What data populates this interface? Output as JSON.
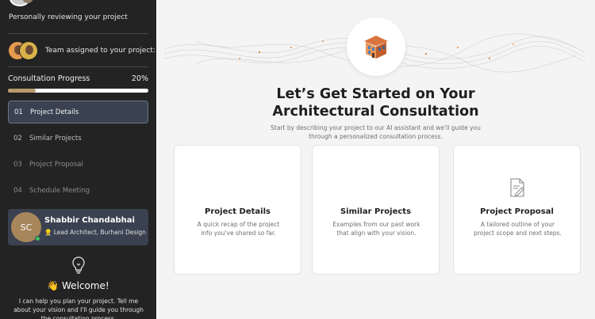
{
  "sidebar": {
    "review_text": "Personally reviewing your project",
    "team_text": "Team assigned to your project:",
    "progress": {
      "label": "Consultation Progress",
      "percent_text": "20%",
      "value": 0.2
    },
    "steps": [
      {
        "num": "01",
        "label": "Project Details"
      },
      {
        "num": "02",
        "label": "Similar Projects"
      },
      {
        "num": "03",
        "label": "Project Proposal"
      },
      {
        "num": "04",
        "label": "Schedule Meeting"
      }
    ],
    "architect": {
      "initials": "SC",
      "name": "Shabbir Chandabhai",
      "role": "👷 Lead Architect, Burhani Design"
    },
    "welcome_title": "👋 Welcome!",
    "welcome_body": "I can help you plan your project. Tell me about your vision and I'll guide you through the consultation process."
  },
  "main": {
    "headline_line1": "Let’s Get Started on Your",
    "headline_line2": "Architectural Consultation",
    "subtext": "Start by describing your project to our AI assistant and we'll guide you through a personalized consultation process.",
    "cards": [
      {
        "title": "Project Details",
        "desc": "A quick recap of the project info you've shared so far."
      },
      {
        "title": "Similar Projects",
        "desc": "Examples from our past work that align with your vision."
      },
      {
        "title": "Project Proposal",
        "desc": "A tailored outline of your project scope and next steps.",
        "icon": "document-edit-icon"
      }
    ]
  },
  "colors": {
    "sidebar_bg": "#232323",
    "active_step_bg": "#3a4150",
    "progress_fill": "#b99a6b",
    "online": "#3cc35a"
  }
}
